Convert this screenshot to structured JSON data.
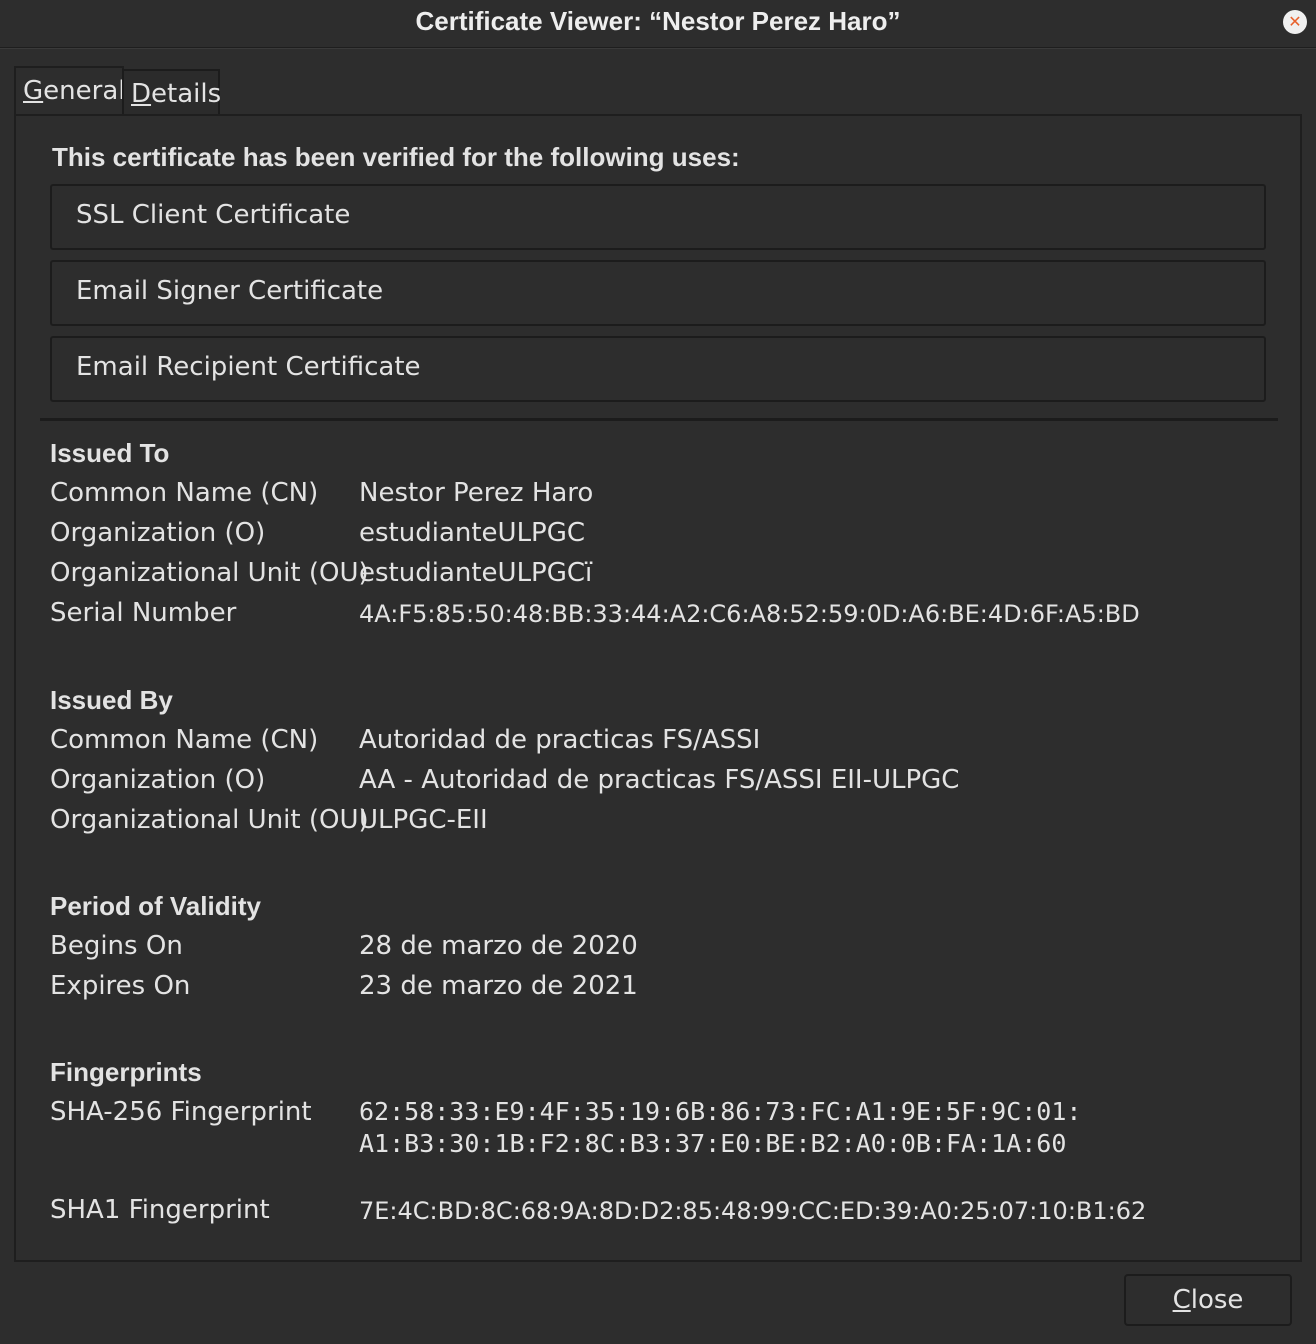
{
  "window": {
    "title": "Certificate Viewer: “Nestor Perez Haro”",
    "close_glyph": "✕"
  },
  "tabs": [
    {
      "mnemonic": "G",
      "rest": "eneral",
      "active": true
    },
    {
      "mnemonic": "D",
      "rest": "etails",
      "active": false
    }
  ],
  "verified": {
    "heading": "This certificate has been verified for the following uses:",
    "uses": [
      "SSL Client Certificate",
      "Email Signer Certificate",
      "Email Recipient Certificate"
    ]
  },
  "issued_to": {
    "title": "Issued To",
    "rows": [
      {
        "label": "Common Name (CN)",
        "value": "Nestor Perez Haro"
      },
      {
        "label": "Organization (O)",
        "value": "estudianteULPGC"
      },
      {
        "label": "Organizational Unit (OU)",
        "value": "estudianteULPGCï"
      },
      {
        "label": "Serial Number",
        "value": "4A:F5:85:50:48:BB:33:44:A2:C6:A8:52:59:0D:A6:BE:4D:6F:A5:BD"
      }
    ]
  },
  "issued_by": {
    "title": "Issued By",
    "rows": [
      {
        "label": "Common Name (CN)",
        "value": "Autoridad de practicas FS/ASSI"
      },
      {
        "label": "Organization (O)",
        "value": "AA - Autoridad de practicas FS/ASSI EII-ULPGC"
      },
      {
        "label": "Organizational Unit (OU)",
        "value": "ULPGC-EII"
      }
    ]
  },
  "validity": {
    "title": "Period of Validity",
    "rows": [
      {
        "label": "Begins On",
        "value": "28 de marzo de 2020"
      },
      {
        "label": "Expires On",
        "value": "23 de marzo de 2021"
      }
    ]
  },
  "fingerprints": {
    "title": "Fingerprints",
    "sha256_label": "SHA-256 Fingerprint",
    "sha256_line1": "62:58:33:E9:4F:35:19:6B:86:73:FC:A1:9E:5F:9C:01:",
    "sha256_line2": "A1:B3:30:1B:F2:8C:B3:37:E0:BE:B2:A0:0B:FA:1A:60",
    "sha1_label": "SHA1 Fingerprint",
    "sha1_value": "7E:4C:BD:8C:68:9A:8D:D2:85:48:99:CC:ED:39:A0:25:07:10:B1:62"
  },
  "footer": {
    "close_mnemonic": "C",
    "close_rest": "lose"
  },
  "colors": {
    "background": "#2d2d2d",
    "border": "#1c1c1c",
    "text": "#e3e3e3",
    "close_icon": "#e8612c"
  }
}
